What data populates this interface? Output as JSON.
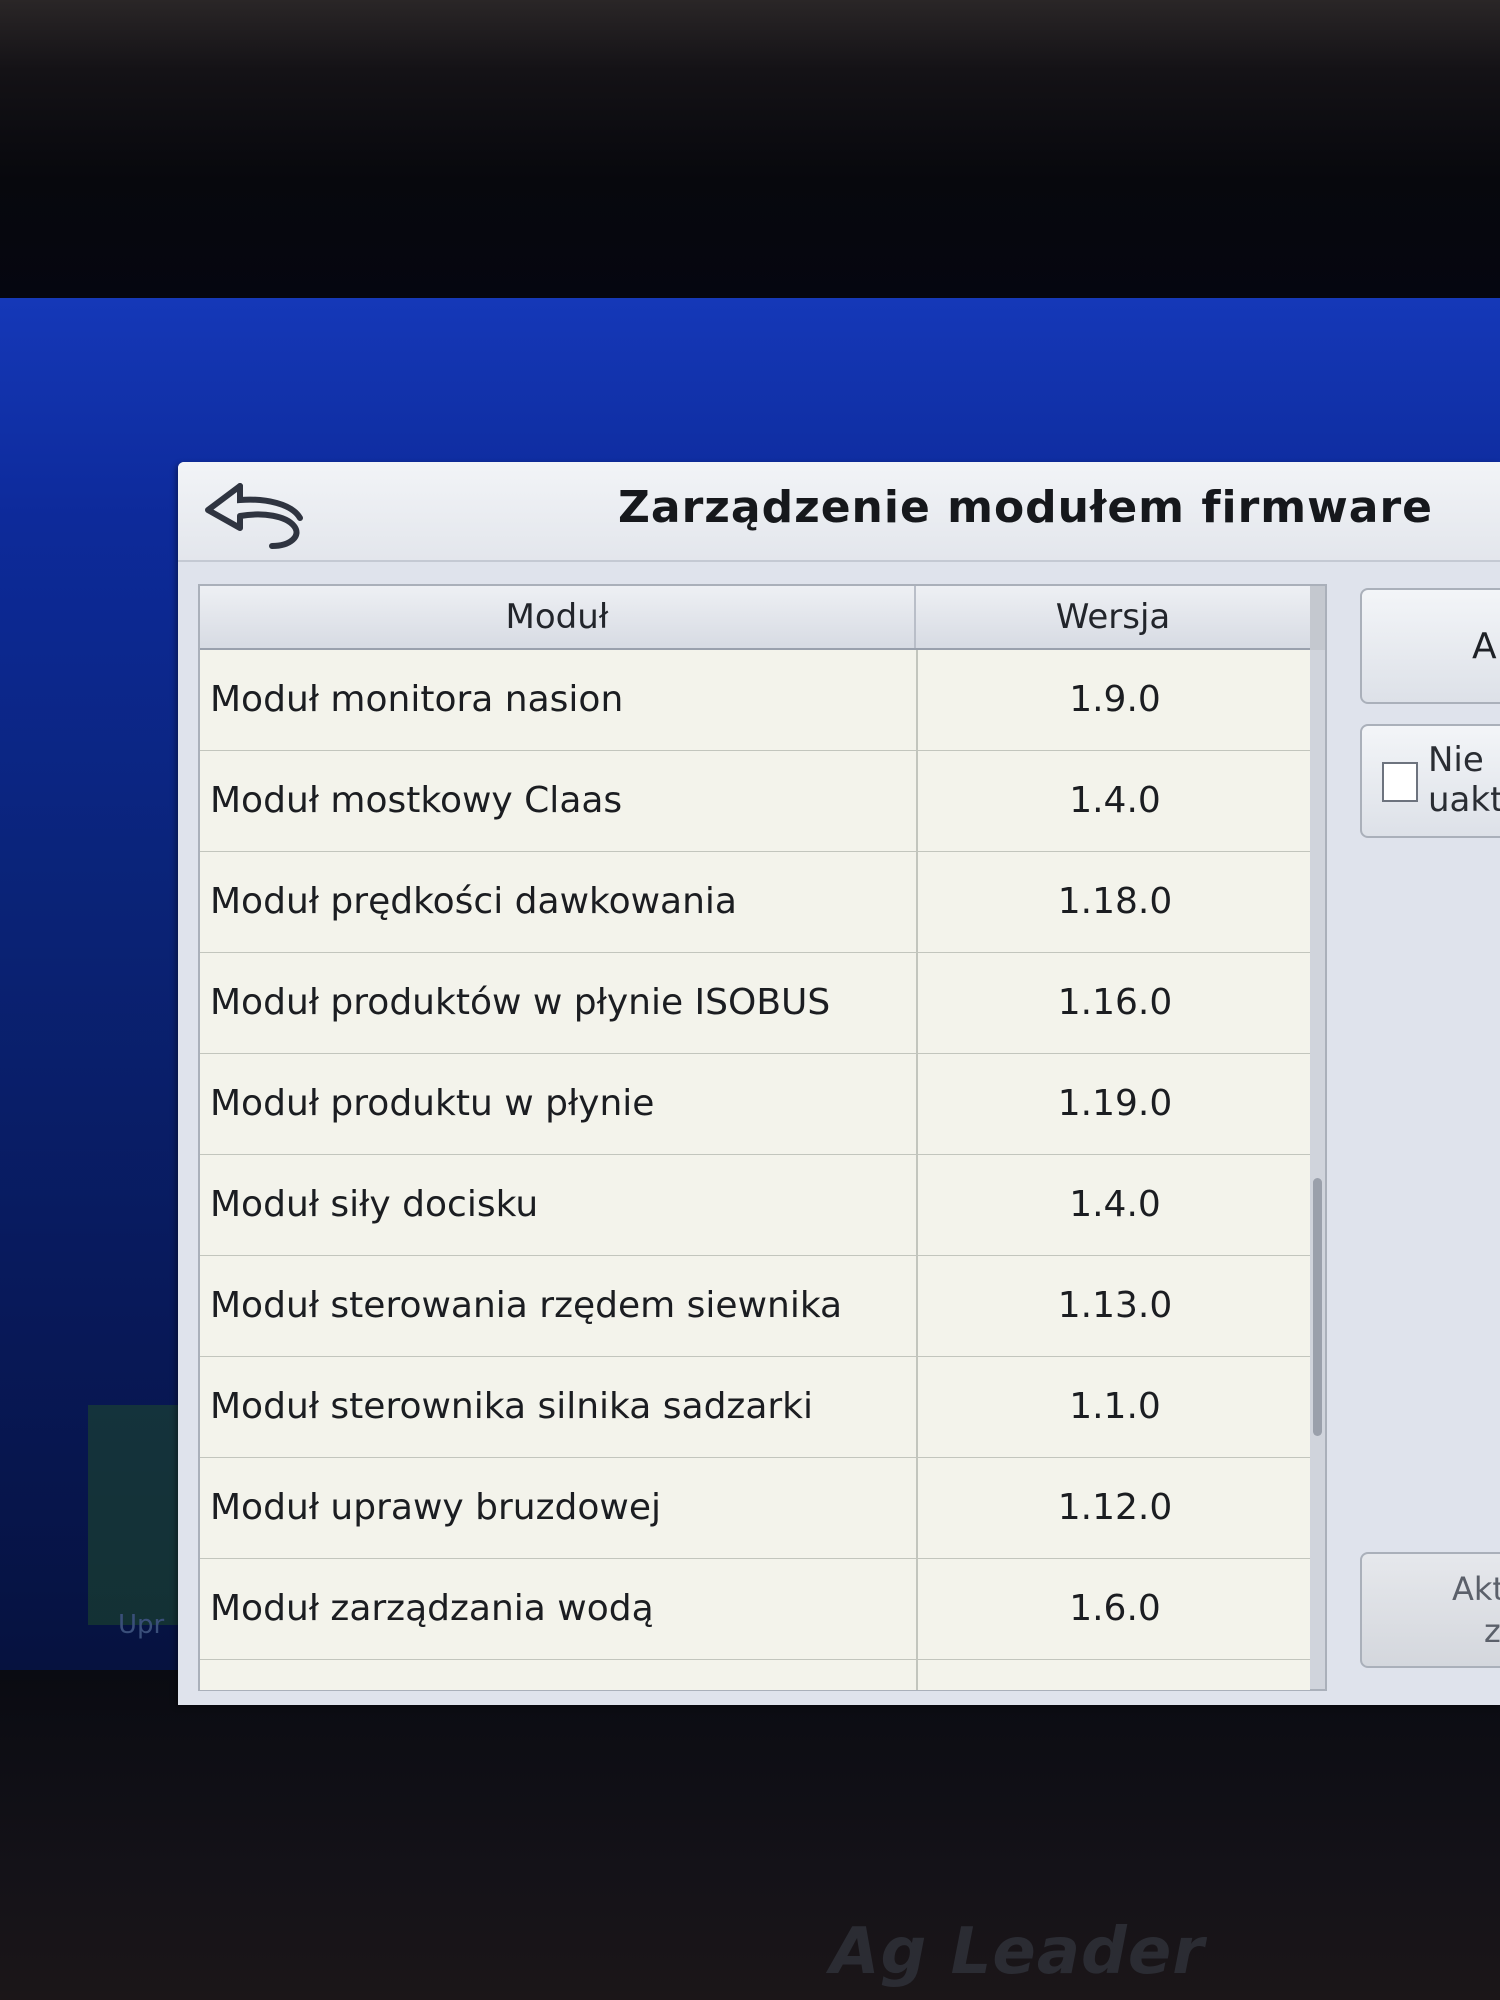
{
  "dialog": {
    "title": "Zarządzenie modułem firmware",
    "back_icon": "undo-arrow-icon"
  },
  "table": {
    "headers": {
      "module": "Moduł",
      "version": "Wersja"
    },
    "rows": [
      {
        "module": "Moduł monitora nasion",
        "version": "1.9.0"
      },
      {
        "module": "Moduł mostkowy Claas",
        "version": "1.4.0"
      },
      {
        "module": "Moduł prędkości dawkowania",
        "version": "1.18.0"
      },
      {
        "module": "Moduł produktów w płynie ISOBUS",
        "version": "1.16.0"
      },
      {
        "module": "Moduł produktu w płynie",
        "version": "1.19.0"
      },
      {
        "module": "Moduł siły docisku",
        "version": "1.4.0"
      },
      {
        "module": "Moduł sterowania rzędem siewnika",
        "version": "1.13.0"
      },
      {
        "module": "Moduł sterownika silnika sadzarki",
        "version": "1.1.0"
      },
      {
        "module": "Moduł uprawy bruzdowej",
        "version": "1.12.0"
      },
      {
        "module": "Moduł zarządzania wodą",
        "version": "1.6.0"
      },
      {
        "module": "",
        "version": ""
      }
    ]
  },
  "side_panel": {
    "top_button_label": "A",
    "checkbox_label_line1": "Nie",
    "checkbox_label_line2": "uakt",
    "checkbox_checked": false,
    "bottom_button_line1": "Akt",
    "bottom_button_line2": "z"
  },
  "background": {
    "tile_label": "Upr",
    "brand": "Ag Leader"
  }
}
